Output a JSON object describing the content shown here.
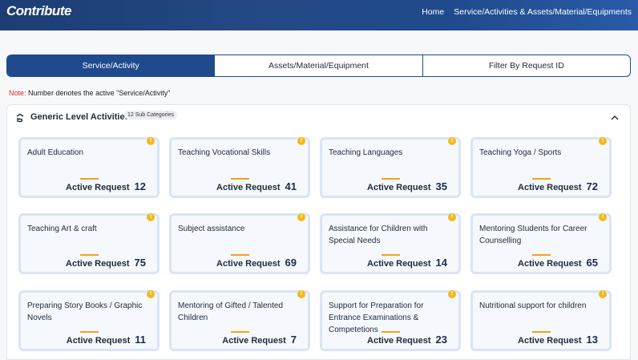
{
  "header": {
    "brand": "Contribute",
    "nav": [
      "Home",
      "Service/Activities & Assets/Material/Equipments"
    ]
  },
  "tabs": [
    {
      "label": "Service/Activity",
      "active": true
    },
    {
      "label": "Assets/Material/Equipment",
      "active": false
    },
    {
      "label": "Filter By Request ID",
      "active": false
    }
  ],
  "note": {
    "prefix": "Note:",
    "text": " Number denotes the active \"Service/Activity\""
  },
  "section": {
    "title": "Generic Level Activities",
    "badge": "12 Sub Categories"
  },
  "card_label": "Active Request",
  "dot_glyph": "!",
  "cards": [
    {
      "title": "Adult Education",
      "count": "12"
    },
    {
      "title": "Teaching Vocational Skills",
      "count": "41"
    },
    {
      "title": "Teaching Languages",
      "count": "35"
    },
    {
      "title": "Teaching Yoga / Sports",
      "count": "72"
    },
    {
      "title": "Teaching Art & craft",
      "count": "75"
    },
    {
      "title": "Subject assistance",
      "count": "69"
    },
    {
      "title": "Assistance for Children with Special Needs",
      "count": "14"
    },
    {
      "title": "Mentoring Students for Career Counselling",
      "count": "65"
    },
    {
      "title": "Preparing Story Books / Graphic Novels",
      "count": "11"
    },
    {
      "title": "Mentoring of Gifted / Talented Children",
      "count": "7"
    },
    {
      "title": "Support for Preparation for Entrance Examinations & Competetions",
      "count": "23"
    },
    {
      "title": "Nutritional support for children",
      "count": "13"
    }
  ],
  "colors": {
    "primary": "#1f4a8c",
    "accent": "#f2b91b",
    "note_red": "#d92b2b"
  },
  "icons": {
    "section": "hand-heart-icon",
    "collapse": "chevron-up-icon",
    "info": "info-dot-icon"
  }
}
